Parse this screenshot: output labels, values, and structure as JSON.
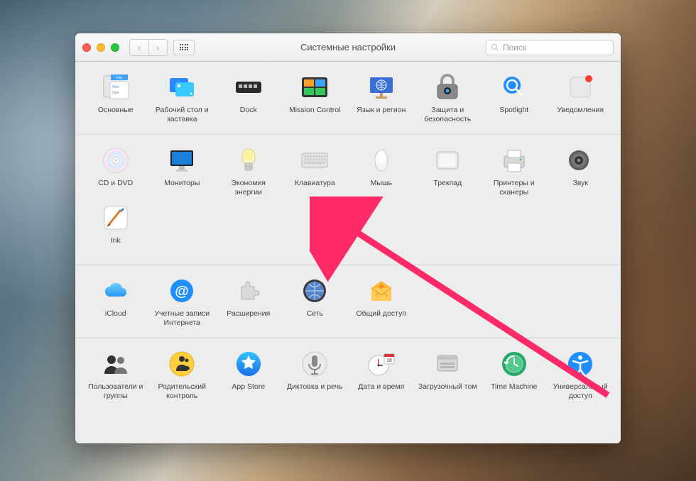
{
  "window": {
    "title": "Системные настройки"
  },
  "toolbar": {
    "back_disabled": true,
    "forward_disabled": true
  },
  "search": {
    "placeholder": "Поиск"
  },
  "arrow_target": "keyboard",
  "sections": [
    {
      "id": "personal",
      "items": [
        {
          "id": "general",
          "label": "Основные",
          "icon": "general-icon"
        },
        {
          "id": "desktop",
          "label": "Рабочий стол и заставка",
          "icon": "desktop-icon"
        },
        {
          "id": "dock",
          "label": "Dock",
          "icon": "dock-icon"
        },
        {
          "id": "mission",
          "label": "Mission Control",
          "icon": "mission-icon"
        },
        {
          "id": "language",
          "label": "Язык и регион",
          "icon": "language-icon"
        },
        {
          "id": "security",
          "label": "Защита и безопасность",
          "icon": "security-icon"
        },
        {
          "id": "spotlight",
          "label": "Spotlight",
          "icon": "spotlight-icon"
        },
        {
          "id": "notifications",
          "label": "Уведомления",
          "icon": "notifications-icon",
          "badge": true
        }
      ]
    },
    {
      "id": "hardware",
      "items": [
        {
          "id": "cddvd",
          "label": "CD и DVD",
          "icon": "cddvd-icon"
        },
        {
          "id": "displays",
          "label": "Мониторы",
          "icon": "displays-icon"
        },
        {
          "id": "energy",
          "label": "Экономия энергии",
          "icon": "energy-icon"
        },
        {
          "id": "keyboard",
          "label": "Клавиатура",
          "icon": "keyboard-icon"
        },
        {
          "id": "mouse",
          "label": "Мышь",
          "icon": "mouse-icon"
        },
        {
          "id": "trackpad",
          "label": "Трекпад",
          "icon": "trackpad-icon"
        },
        {
          "id": "printers",
          "label": "Принтеры и сканеры",
          "icon": "printers-icon"
        },
        {
          "id": "sound",
          "label": "Звук",
          "icon": "sound-icon"
        },
        {
          "id": "ink",
          "label": "Ink",
          "icon": "ink-icon"
        }
      ]
    },
    {
      "id": "internet",
      "items": [
        {
          "id": "icloud",
          "label": "iCloud",
          "icon": "icloud-icon"
        },
        {
          "id": "accounts",
          "label": "Учетные записи Интернета",
          "icon": "accounts-icon"
        },
        {
          "id": "extensions",
          "label": "Расширения",
          "icon": "extensions-icon"
        },
        {
          "id": "network",
          "label": "Сеть",
          "icon": "network-icon"
        },
        {
          "id": "sharing",
          "label": "Общий доступ",
          "icon": "sharing-icon"
        }
      ]
    },
    {
      "id": "system",
      "items": [
        {
          "id": "users",
          "label": "Пользователи и группы",
          "icon": "users-icon"
        },
        {
          "id": "parental",
          "label": "Родительский контроль",
          "icon": "parental-icon"
        },
        {
          "id": "appstore",
          "label": "App Store",
          "icon": "appstore-icon"
        },
        {
          "id": "dictation",
          "label": "Диктовка и речь",
          "icon": "dictation-icon"
        },
        {
          "id": "datetime",
          "label": "Дата и время",
          "icon": "datetime-icon"
        },
        {
          "id": "startup",
          "label": "Загрузочный том",
          "icon": "startup-icon"
        },
        {
          "id": "timemachine",
          "label": "Time Machine",
          "icon": "timemachine-icon"
        },
        {
          "id": "accessibility",
          "label": "Универсальный доступ",
          "icon": "accessibility-icon"
        }
      ]
    }
  ]
}
